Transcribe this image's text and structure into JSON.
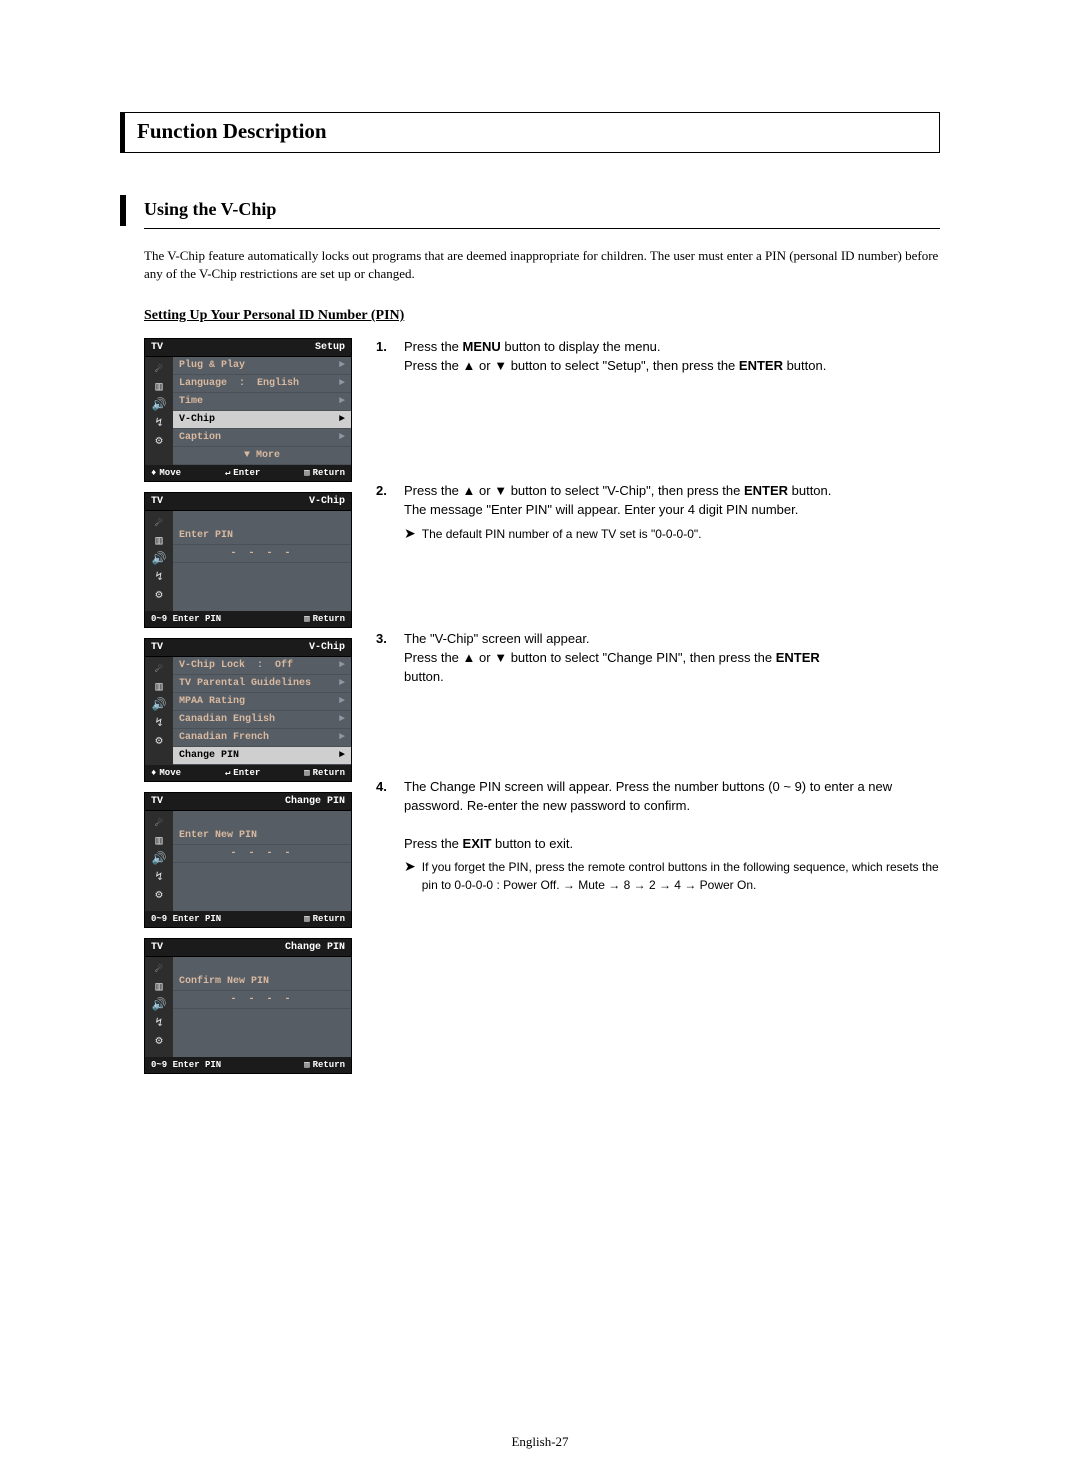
{
  "page": {
    "section_title": "Function Description",
    "sub_title": "Using the V-Chip",
    "intro": "The V-Chip feature automatically locks out programs that are deemed inappropriate for children. The user must enter a PIN (personal ID number) before any of the V-Chip restrictions are set up or changed.",
    "setup_heading": "Setting Up Your Personal ID Number (PIN)",
    "footer": "English-27"
  },
  "symbols": {
    "up": "▲",
    "down": "▼",
    "right": "►",
    "updown": "♦",
    "enter_glyph": "↵",
    "return_glyph": "▥",
    "note": "➤",
    "dash4": "- - - -",
    "arrow": "→"
  },
  "osd_common": {
    "tv": "TV",
    "move": "Move",
    "enter": "Enter",
    "return": "Return",
    "enter_pin_hint": "0~9 Enter PIN"
  },
  "osd1": {
    "title": "Setup",
    "rows": {
      "plug_play": "Plug & Play",
      "language": "Language",
      "language_val": "English",
      "time": "Time",
      "vchip": "V-Chip",
      "caption": "Caption",
      "more": "More"
    }
  },
  "osd2": {
    "title": "V-Chip",
    "label": "Enter PIN"
  },
  "osd3": {
    "title": "V-Chip",
    "rows": {
      "lock": "V-Chip Lock",
      "lock_val": "Off",
      "tv_guide": "TV Parental Guidelines",
      "mpaa": "MPAA Rating",
      "can_en": "Canadian English",
      "can_fr": "Canadian French",
      "change_pin": "Change PIN"
    }
  },
  "osd4": {
    "title": "Change PIN",
    "label": "Enter New PIN"
  },
  "osd5": {
    "title": "Change PIN",
    "label": "Confirm New PIN"
  },
  "steps": {
    "s1": {
      "num": "1.",
      "a": "Press the ",
      "menu": "MENU",
      "b": " button to display the menu.",
      "c": "Press the ",
      "d": " or ",
      "e": " button to select \"Setup\", then press the ",
      "enter": "ENTER",
      "f": " button."
    },
    "s2": {
      "num": "2.",
      "a": "Press the ",
      "b": " or ",
      "c": " button to select \"V-Chip\", then press the ",
      "enter": "ENTER",
      "d": " button.",
      "e": "The message \"Enter PIN\" will appear. Enter your 4 digit PIN number.",
      "note": "The default PIN number of a new TV set is \"0-0-0-0\"."
    },
    "s3": {
      "num": "3.",
      "a": "The \"V-Chip\" screen will appear.",
      "b": "Press the ",
      "c": " or ",
      "d": " button to select \"Change PIN\", then press the ",
      "enter": "ENTER",
      "e": "button."
    },
    "s4": {
      "num": "4.",
      "a": "The Change PIN screen will appear. Press the number buttons (0 ~ 9) to enter a new password. Re-enter the new password to confirm.",
      "b": "Press the ",
      "exit": "EXIT",
      "c": " button to exit.",
      "note1": "If you forget the PIN, press the remote control buttons in the following sequence, which resets the pin to 0-0-0-0 : Power Off. ",
      "seq": " Mute ",
      "n8": " 8 ",
      "n2": " 2 ",
      "n4": " 4 ",
      "pon": " Power On."
    }
  }
}
